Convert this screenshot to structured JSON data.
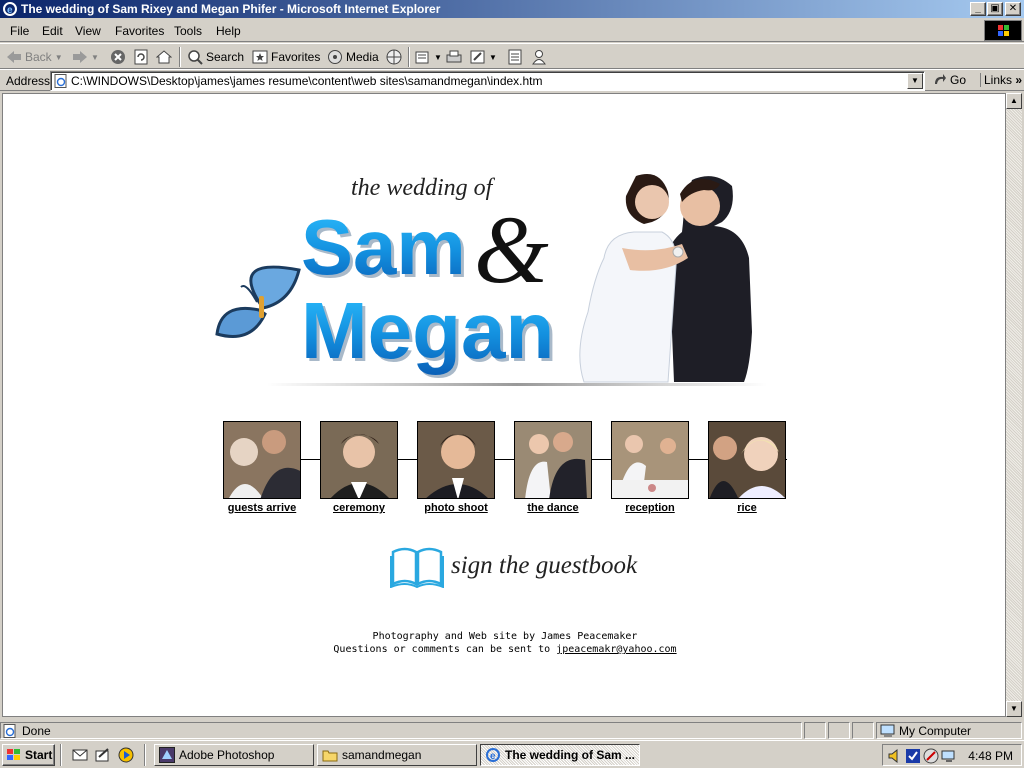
{
  "window": {
    "title": "The wedding of Sam Rixey and Megan Phifer - Microsoft Internet Explorer",
    "minimize": "_",
    "maximize": "▣",
    "close": "✕"
  },
  "menu": {
    "items": [
      "File",
      "Edit",
      "View",
      "Favorites",
      "Tools",
      "Help"
    ]
  },
  "toolbar": {
    "back": "Back",
    "search": "Search",
    "favorites": "Favorites",
    "media": "Media"
  },
  "address": {
    "label": "Address",
    "url": "C:\\WINDOWS\\Desktop\\james\\james resume\\content\\web sites\\samandmegan\\index.htm",
    "go": "Go",
    "links": "Links"
  },
  "page": {
    "logo": {
      "subtitle": "the wedding of",
      "name1": "Sam",
      "ampersand": "&",
      "name2": "Megan"
    },
    "thumbnails": [
      "guests arrive",
      "ceremony",
      "photo shoot",
      "the dance",
      "reception",
      "rice"
    ],
    "guestbook": "sign the guestbook",
    "credit_line": "Photography and Web site by James Peacemaker",
    "contact_prefix": "Questions or comments can be sent to ",
    "contact_email": "jpeacemakr@yahoo.com"
  },
  "status": {
    "text": "Done",
    "zone": "My Computer"
  },
  "taskbar": {
    "start": "Start",
    "tasks": [
      "Adobe Photoshop",
      "samandmegan",
      "The wedding of Sam ..."
    ],
    "clock": "4:48 PM"
  },
  "colors": {
    "title_active_start": "#0a246a",
    "title_active_end": "#a6caf0",
    "logo_blue": "#1aa3e8",
    "chrome": "#d4d0c8"
  }
}
